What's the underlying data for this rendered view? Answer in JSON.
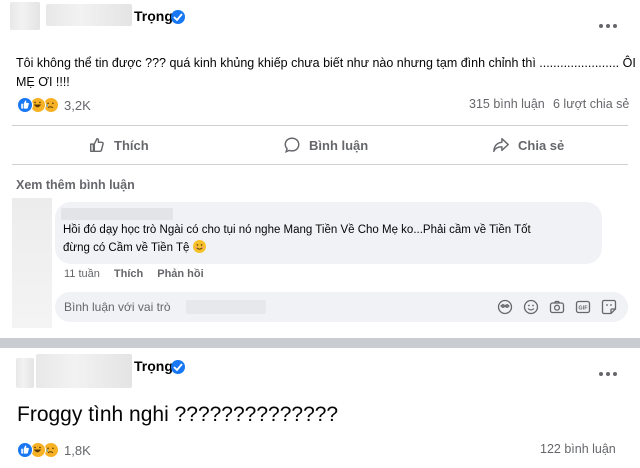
{
  "post1": {
    "author_name": "Trọng",
    "text_line1": "Tôi không thể tin được ??? quá kinh khủng khiếp chưa biết như nào nhưng tạm đình chỉnh thì ....................... ÔI",
    "text_line2": "MẸ ƠI !!!!",
    "reaction_count": "3,2K",
    "comment_count": "315 bình luận",
    "share_count": "6 lượt chia sẻ",
    "actions": {
      "like": "Thích",
      "comment": "Bình luận",
      "share": "Chia sẻ"
    },
    "see_more_comments": "Xem thêm bình luận",
    "comment": {
      "text_line1": "Hồi đó dạy học trò Ngài có cho tụi nó nghe Mang Tiền Về Cho Mẹ ko...Phải cầm về Tiền Tốt",
      "text_line2": "đừng có Cầm về Tiền Tệ",
      "time": "11 tuần",
      "like": "Thích",
      "reply": "Phản hồi"
    },
    "reply_placeholder": "Bình luận với vai trò"
  },
  "post2": {
    "author_name": "Trọng",
    "text": "Froggy tình nghi ??????????????",
    "reaction_count": "1,8K",
    "comment_count": "122 bình luận"
  },
  "colors": {
    "brand": "#1877f2",
    "secondary_text": "#65676b",
    "bubble": "#f0f2f5"
  }
}
